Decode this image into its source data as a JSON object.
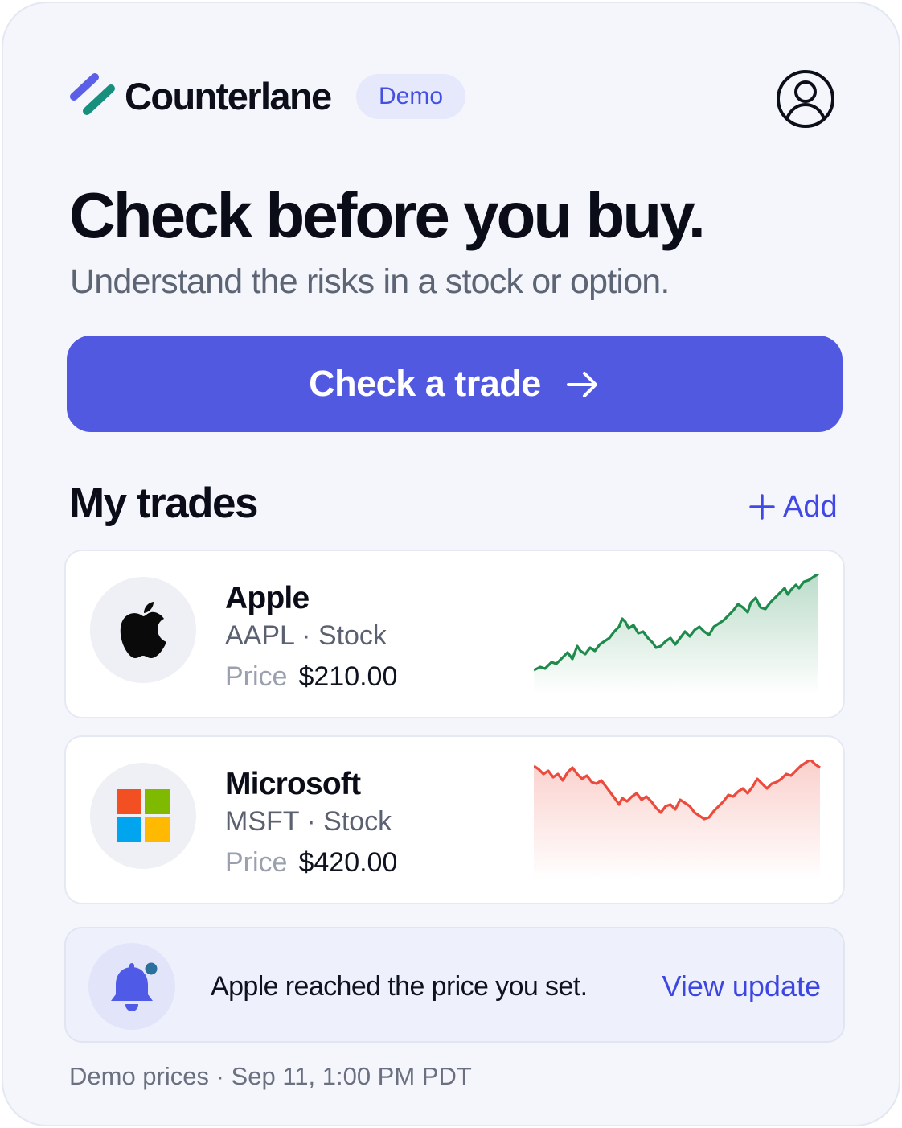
{
  "header": {
    "brand": "Counterlane",
    "badge": "Demo",
    "logo_icon": "counterlane-logo-icon",
    "profile_icon": "user-circle-icon"
  },
  "hero": {
    "headline": "Check before you buy.",
    "subhead": "Understand the risks in a stock or option.",
    "cta_label": "Check a trade",
    "cta_icon": "arrow-right-icon"
  },
  "trades_section": {
    "title": "My trades",
    "add_label": "Add",
    "add_icon": "plus-icon"
  },
  "trades": [
    {
      "name": "Apple",
      "meta": "AAPL · Stock",
      "price_label": "Price",
      "price": "$210.00",
      "icon": "apple-logo-icon",
      "trend": "up",
      "sparkline_color": "#1e8a4c"
    },
    {
      "name": "Microsoft",
      "meta": "MSFT · Stock",
      "price_label": "Price",
      "price": "$420.00",
      "icon": "microsoft-logo-icon",
      "trend": "down",
      "sparkline_color": "#ec4a3c"
    }
  ],
  "alert": {
    "text": "Apple reached the price you set.",
    "link": "View update",
    "icon": "bell-icon"
  },
  "footer": {
    "note": "Demo prices · Sep 11, 1:00 PM PDT"
  },
  "colors": {
    "accent": "#5059e0",
    "link": "#3c46e0",
    "up": "#1e8a4c",
    "down": "#ec4a3c"
  }
}
